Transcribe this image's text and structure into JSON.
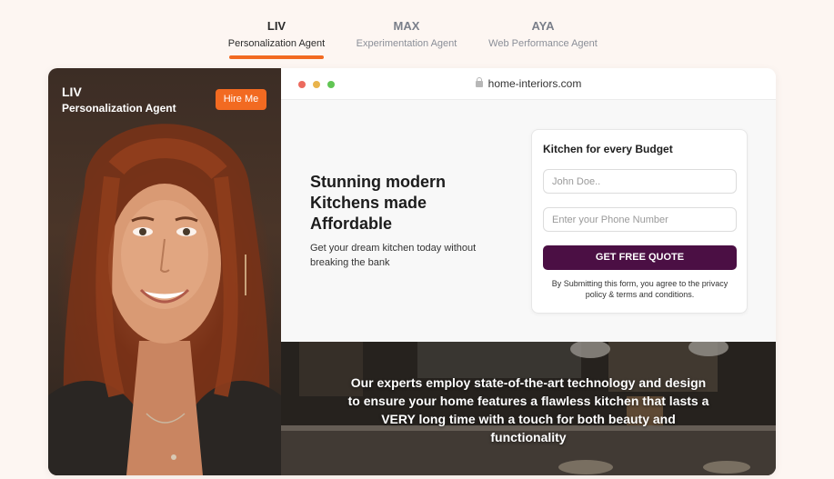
{
  "tabs": [
    {
      "name": "LIV",
      "subtitle": "Personalization Agent",
      "active": true
    },
    {
      "name": "MAX",
      "subtitle": "Experimentation Agent",
      "active": false
    },
    {
      "name": "AYA",
      "subtitle": "Web Performance Agent",
      "active": false
    }
  ],
  "agent": {
    "name": "LIV",
    "role": "Personalization Agent",
    "hire_label": "Hire Me"
  },
  "browser": {
    "url": "home-interiors.com",
    "icons": {
      "lock": "lock-icon"
    }
  },
  "hero": {
    "title": "Stunning modern Kitchens made Affordable",
    "subtitle": "Get your dream kitchen today without breaking the bank"
  },
  "form": {
    "title": "Kitchen for every Budget",
    "name_placeholder": "John Doe..",
    "phone_placeholder": "Enter your Phone Number",
    "submit_label": "GET FREE QUOTE",
    "disclaimer": "By Submitting this form, you agree to the privacy policy & terms and conditions."
  },
  "banner": {
    "text": "Our experts employ state-of-the-art technology and design to ensure your home features a flawless kitchen that lasts a VERY long time with a touch for both beauty and functionality"
  },
  "colors": {
    "accent": "#f26a21",
    "cta": "#4b0f44",
    "background": "#fdf6f2"
  }
}
